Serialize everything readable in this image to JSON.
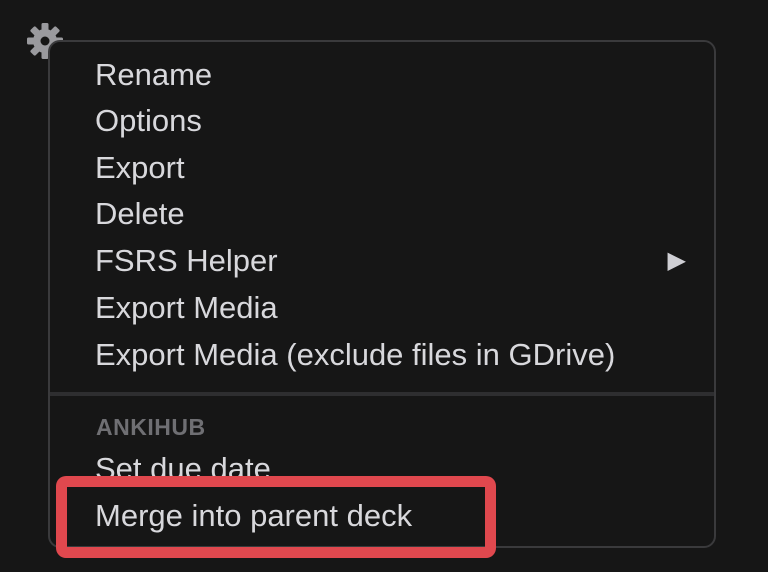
{
  "gear_button": {
    "icon": "gear-icon"
  },
  "menu": {
    "items": [
      {
        "label": "Rename"
      },
      {
        "label": "Options"
      },
      {
        "label": "Export"
      },
      {
        "label": "Delete"
      },
      {
        "label": "FSRS Helper",
        "submenu_icon": "triangle-right-icon"
      },
      {
        "label": "Export Media"
      },
      {
        "label": "Export Media (exclude files in GDrive)"
      }
    ],
    "section_header": "ANKIHUB",
    "ankihub_items": [
      {
        "label": "Set due date"
      },
      {
        "label": "Merge into parent deck",
        "highlighted": true
      }
    ],
    "submenu_arrow_glyph": "▶"
  },
  "colors": {
    "background": "#161616",
    "menu_border": "#3a3a3c",
    "text": "#d8d8dc",
    "section_header": "#6f6f73",
    "highlight": "#e0484e"
  }
}
